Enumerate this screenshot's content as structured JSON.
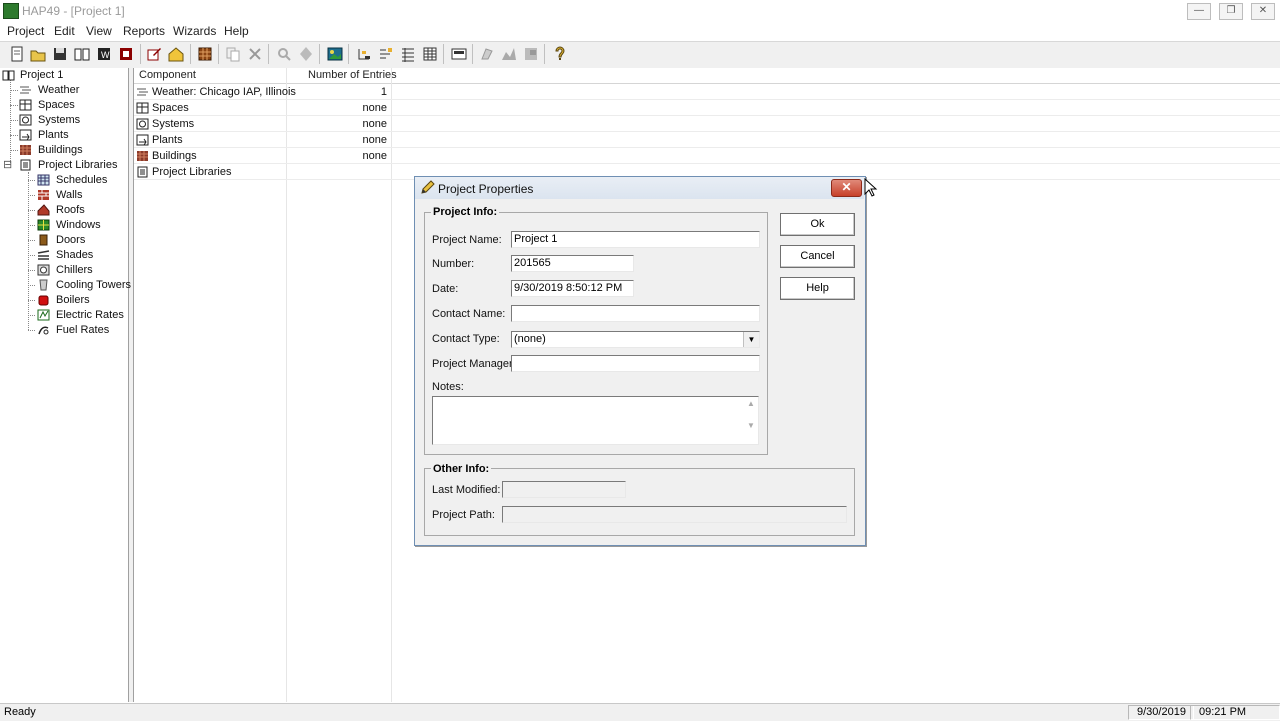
{
  "window": {
    "title": "HAP49 - [Project 1]",
    "controls": [
      "minimize",
      "restore",
      "close"
    ]
  },
  "menu": [
    {
      "label": "Project",
      "accel": "P"
    },
    {
      "label": "Edit",
      "accel": "E"
    },
    {
      "label": "View",
      "accel": "V"
    },
    {
      "label": "Reports",
      "accel": "R"
    },
    {
      "label": "Wizards",
      "accel": "W"
    },
    {
      "label": "Help",
      "accel": "H"
    }
  ],
  "toolbar": {
    "icons": [
      "new-project-icon",
      "open-project-icon",
      "save-icon",
      "book-icon",
      "book-dark-icon",
      "exit-icon",
      "edit-pencil-icon",
      "house-icon",
      "grid-icon",
      "copy-icon",
      "delete-icon",
      "search-icon",
      "properties-icon",
      "image-icon",
      "tree-icon",
      "tree-branch-icon",
      "details-view-icon",
      "list-view-icon",
      "report-icon",
      "print-icon",
      "chart-icon",
      "calculator-icon",
      "help-icon"
    ]
  },
  "tree": {
    "root": "Project 1",
    "items": [
      {
        "label": "Weather",
        "icon": "weather-icon"
      },
      {
        "label": "Spaces",
        "icon": "spaces-icon"
      },
      {
        "label": "Systems",
        "icon": "systems-icon"
      },
      {
        "label": "Plants",
        "icon": "plants-icon"
      },
      {
        "label": "Buildings",
        "icon": "buildings-icon"
      }
    ],
    "libraries": {
      "label": "Project Libraries",
      "expander": "⊟",
      "items": [
        {
          "label": "Schedules",
          "icon": "schedules-icon"
        },
        {
          "label": "Walls",
          "icon": "walls-icon"
        },
        {
          "label": "Roofs",
          "icon": "roofs-icon"
        },
        {
          "label": "Windows",
          "icon": "windows-icon"
        },
        {
          "label": "Doors",
          "icon": "doors-icon"
        },
        {
          "label": "Shades",
          "icon": "shades-icon"
        },
        {
          "label": "Chillers",
          "icon": "chillers-icon"
        },
        {
          "label": "Cooling Towers",
          "icon": "cooling-towers-icon"
        },
        {
          "label": "Boilers",
          "icon": "boilers-icon"
        },
        {
          "label": "Electric Rates",
          "icon": "electric-rates-icon"
        },
        {
          "label": "Fuel Rates",
          "icon": "fuel-rates-icon"
        }
      ]
    }
  },
  "list": {
    "columns": [
      "Component",
      "Number of Entries"
    ],
    "rows": [
      {
        "component": "Weather: Chicago IAP, Illinois",
        "entries": "1",
        "icon": "weather-icon"
      },
      {
        "component": "Spaces",
        "entries": "none",
        "icon": "spaces-icon"
      },
      {
        "component": "Systems",
        "entries": "none",
        "icon": "systems-icon"
      },
      {
        "component": "Plants",
        "entries": "none",
        "icon": "plants-icon"
      },
      {
        "component": "Buildings",
        "entries": "none",
        "icon": "buildings-icon"
      },
      {
        "component": "Project Libraries",
        "entries": "",
        "icon": "libraries-icon"
      }
    ]
  },
  "status": {
    "text": "Ready",
    "date": "9/30/2019",
    "time": "09:21 PM"
  },
  "dialog": {
    "title": "Project Properties",
    "project_info_label": "Project Info:",
    "fields": {
      "project_name": {
        "label": "Project Name:",
        "value": "Project 1"
      },
      "number": {
        "label": "Number:",
        "value": "201565"
      },
      "date": {
        "label": "Date:",
        "value": "9/30/2019 8:50:12 PM"
      },
      "contact_name": {
        "label": "Contact Name:",
        "value": ""
      },
      "contact_type": {
        "label": "Contact Type:",
        "value": "(none)"
      },
      "project_manager": {
        "label": "Project Manager:",
        "value": ""
      },
      "notes": {
        "label": "Notes:",
        "value": ""
      }
    },
    "other_info_label": "Other Info:",
    "other": {
      "last_modified": {
        "label": "Last Modified:",
        "value": ""
      },
      "project_path": {
        "label": "Project Path:",
        "value": ""
      }
    },
    "buttons": {
      "ok": "Ok",
      "cancel": "Cancel",
      "help": "Help"
    },
    "close_glyph": "✕"
  },
  "colors": {
    "dialog_border": "#6f8fb3",
    "close_button": "#c7402a",
    "chrome": "#f0f0f0"
  }
}
